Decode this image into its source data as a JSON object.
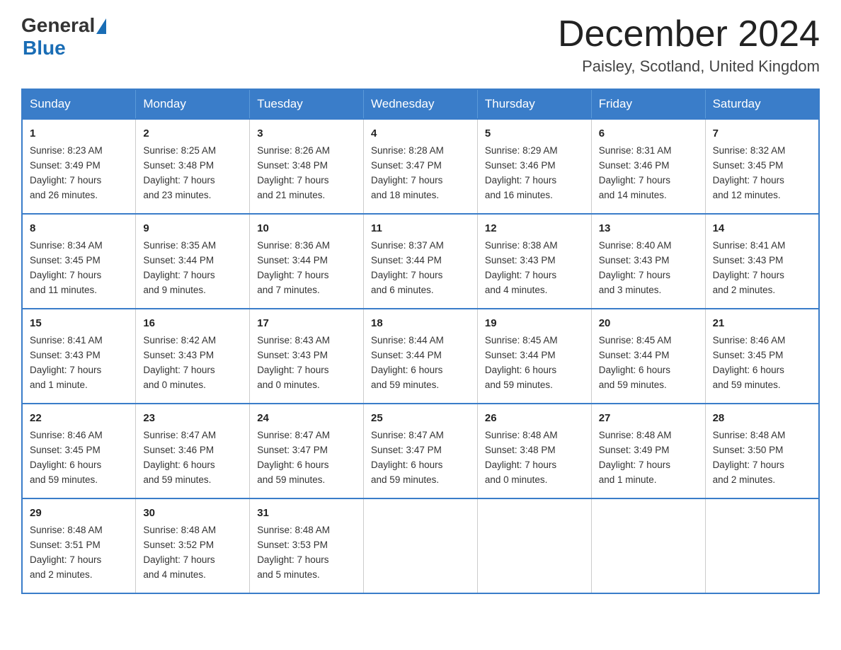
{
  "logo": {
    "text_general": "General",
    "text_blue": "Blue",
    "triangle": "▶"
  },
  "header": {
    "title": "December 2024",
    "subtitle": "Paisley, Scotland, United Kingdom"
  },
  "days_of_week": [
    "Sunday",
    "Monday",
    "Tuesday",
    "Wednesday",
    "Thursday",
    "Friday",
    "Saturday"
  ],
  "weeks": [
    [
      {
        "day": "1",
        "sunrise": "8:23 AM",
        "sunset": "3:49 PM",
        "daylight": "7 hours and 26 minutes."
      },
      {
        "day": "2",
        "sunrise": "8:25 AM",
        "sunset": "3:48 PM",
        "daylight": "7 hours and 23 minutes."
      },
      {
        "day": "3",
        "sunrise": "8:26 AM",
        "sunset": "3:48 PM",
        "daylight": "7 hours and 21 minutes."
      },
      {
        "day": "4",
        "sunrise": "8:28 AM",
        "sunset": "3:47 PM",
        "daylight": "7 hours and 18 minutes."
      },
      {
        "day": "5",
        "sunrise": "8:29 AM",
        "sunset": "3:46 PM",
        "daylight": "7 hours and 16 minutes."
      },
      {
        "day": "6",
        "sunrise": "8:31 AM",
        "sunset": "3:46 PM",
        "daylight": "7 hours and 14 minutes."
      },
      {
        "day": "7",
        "sunrise": "8:32 AM",
        "sunset": "3:45 PM",
        "daylight": "7 hours and 12 minutes."
      }
    ],
    [
      {
        "day": "8",
        "sunrise": "8:34 AM",
        "sunset": "3:45 PM",
        "daylight": "7 hours and 11 minutes."
      },
      {
        "day": "9",
        "sunrise": "8:35 AM",
        "sunset": "3:44 PM",
        "daylight": "7 hours and 9 minutes."
      },
      {
        "day": "10",
        "sunrise": "8:36 AM",
        "sunset": "3:44 PM",
        "daylight": "7 hours and 7 minutes."
      },
      {
        "day": "11",
        "sunrise": "8:37 AM",
        "sunset": "3:44 PM",
        "daylight": "7 hours and 6 minutes."
      },
      {
        "day": "12",
        "sunrise": "8:38 AM",
        "sunset": "3:43 PM",
        "daylight": "7 hours and 4 minutes."
      },
      {
        "day": "13",
        "sunrise": "8:40 AM",
        "sunset": "3:43 PM",
        "daylight": "7 hours and 3 minutes."
      },
      {
        "day": "14",
        "sunrise": "8:41 AM",
        "sunset": "3:43 PM",
        "daylight": "7 hours and 2 minutes."
      }
    ],
    [
      {
        "day": "15",
        "sunrise": "8:41 AM",
        "sunset": "3:43 PM",
        "daylight": "7 hours and 1 minute."
      },
      {
        "day": "16",
        "sunrise": "8:42 AM",
        "sunset": "3:43 PM",
        "daylight": "7 hours and 0 minutes."
      },
      {
        "day": "17",
        "sunrise": "8:43 AM",
        "sunset": "3:43 PM",
        "daylight": "7 hours and 0 minutes."
      },
      {
        "day": "18",
        "sunrise": "8:44 AM",
        "sunset": "3:44 PM",
        "daylight": "6 hours and 59 minutes."
      },
      {
        "day": "19",
        "sunrise": "8:45 AM",
        "sunset": "3:44 PM",
        "daylight": "6 hours and 59 minutes."
      },
      {
        "day": "20",
        "sunrise": "8:45 AM",
        "sunset": "3:44 PM",
        "daylight": "6 hours and 59 minutes."
      },
      {
        "day": "21",
        "sunrise": "8:46 AM",
        "sunset": "3:45 PM",
        "daylight": "6 hours and 59 minutes."
      }
    ],
    [
      {
        "day": "22",
        "sunrise": "8:46 AM",
        "sunset": "3:45 PM",
        "daylight": "6 hours and 59 minutes."
      },
      {
        "day": "23",
        "sunrise": "8:47 AM",
        "sunset": "3:46 PM",
        "daylight": "6 hours and 59 minutes."
      },
      {
        "day": "24",
        "sunrise": "8:47 AM",
        "sunset": "3:47 PM",
        "daylight": "6 hours and 59 minutes."
      },
      {
        "day": "25",
        "sunrise": "8:47 AM",
        "sunset": "3:47 PM",
        "daylight": "6 hours and 59 minutes."
      },
      {
        "day": "26",
        "sunrise": "8:48 AM",
        "sunset": "3:48 PM",
        "daylight": "7 hours and 0 minutes."
      },
      {
        "day": "27",
        "sunrise": "8:48 AM",
        "sunset": "3:49 PM",
        "daylight": "7 hours and 1 minute."
      },
      {
        "day": "28",
        "sunrise": "8:48 AM",
        "sunset": "3:50 PM",
        "daylight": "7 hours and 2 minutes."
      }
    ],
    [
      {
        "day": "29",
        "sunrise": "8:48 AM",
        "sunset": "3:51 PM",
        "daylight": "7 hours and 2 minutes."
      },
      {
        "day": "30",
        "sunrise": "8:48 AM",
        "sunset": "3:52 PM",
        "daylight": "7 hours and 4 minutes."
      },
      {
        "day": "31",
        "sunrise": "8:48 AM",
        "sunset": "3:53 PM",
        "daylight": "7 hours and 5 minutes."
      },
      null,
      null,
      null,
      null
    ]
  ],
  "labels": {
    "sunrise": "Sunrise:",
    "sunset": "Sunset:",
    "daylight": "Daylight:"
  }
}
